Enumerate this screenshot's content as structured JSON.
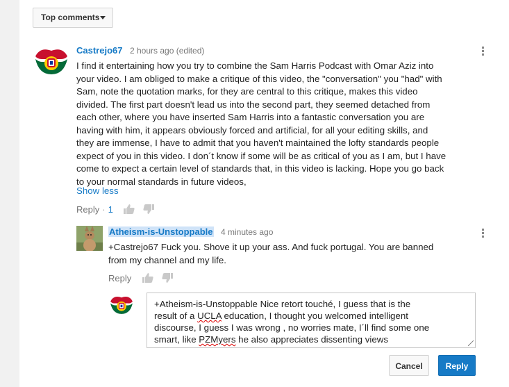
{
  "sort": {
    "label": "Top comments"
  },
  "comment": {
    "author": "Castrejo67",
    "time": "2 hours ago (edited)",
    "lines": [
      "I find it entertaining how you try to combine the Sam Harris Podcast with Omar Aziz into",
      "your video. I am obliged to make a critique of this video, the \"conversation\" you \"had\" with",
      "Sam, note the quotation marks, for they are central to this critique, makes this video",
      "divided. The first part doesn't lead us into the second part, they seemed detached from",
      "each other, where you have inserted Sam Harris into a fantastic conversation you are",
      "having with him, it appears obviously forced and artificial, for all your editing skills, and",
      "they are immense, I have to admit that you haven't maintained the lofty standards people",
      "expect of you in this video. I don´t know if some will be as critical of you as I am, but I have",
      "come to expect a certain level of standards that, in this video is lacking. Hope you go back",
      "to your normal standards in future videos,"
    ],
    "show_less": "Show less",
    "reply_label": "Reply",
    "reply_count": "1"
  },
  "reply": {
    "author": "Atheism-is-Unstoppable",
    "time": "4 minutes ago",
    "lines": [
      "+Castrejo67 Fuck you. Shove it up your ass. And fuck portugal. You are banned",
      "from my channel and my life."
    ],
    "reply_label": "Reply"
  },
  "compose": {
    "line1": "+Atheism-is-Unstoppable Nice retort touché, I guess that is the",
    "line2a": "result of a ",
    "line2b": "UCLA",
    "line2c": " education, I thought you welcomed intelligent",
    "line3": "discourse, I guess I was wrong , no worries mate, I´ll find some one",
    "line4a": "smart, like ",
    "line4b": "PZMyers",
    "line4c": "  he also appreciates dissenting views",
    "cancel_label": "Cancel",
    "reply_label": "Reply"
  },
  "icons": {
    "sort": "caret-down-icon",
    "like": "thumbs-up-icon",
    "dislike": "thumbs-down-icon",
    "menu": "more-vertical-icon"
  }
}
